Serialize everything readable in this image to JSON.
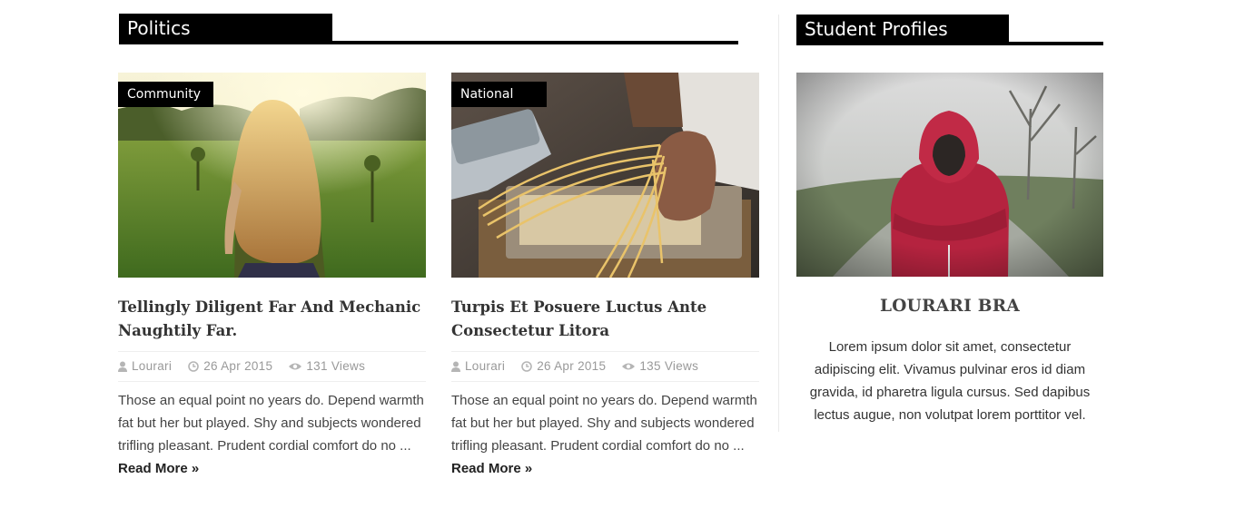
{
  "sections": {
    "politics": {
      "title": "Politics"
    },
    "profiles": {
      "title": "Student Profiles"
    }
  },
  "posts": [
    {
      "category": "Community",
      "title": "Tellingly Diligent Far And Mechanic Naughtily Far.",
      "author": "Lourari",
      "date": "26 Apr 2015",
      "views": "131 Views",
      "excerpt": "Those an equal point no years do. Depend warmth fat but her but played. Shy and subjects wondered trifling pleasant. Prudent cordial comfort do no ...",
      "read_more": "Read More »",
      "image": "girl-in-sunlit-field"
    },
    {
      "category": "National",
      "title": "Turpis Et Posuere Luctus Ante Consectetur Litora",
      "author": "Lourari",
      "date": "26 Apr 2015",
      "views": "135 Views",
      "excerpt": "Those an equal point no years do. Depend warmth fat but her but played. Shy and subjects wondered trifling pleasant. Prudent cordial comfort do no ...",
      "read_more": "Read More »",
      "image": "hands-making-pasta"
    }
  ],
  "profile": {
    "name": "LOURARI BRA",
    "bio": "Lorem ipsum dolor sit amet, consectetur adipiscing elit. Vivamus pulvinar eros id diam gravida, id pharetra ligula cursus. Sed dapibus lectus augue, non volutpat lorem porttitor vel.",
    "image": "person-in-red-hoodie"
  },
  "icons": {
    "author": "user-icon",
    "date": "clock-icon",
    "views": "eye-icon"
  },
  "colors": {
    "label_bg": "#000000",
    "label_text": "#ffffff",
    "meta_text": "#999999"
  }
}
